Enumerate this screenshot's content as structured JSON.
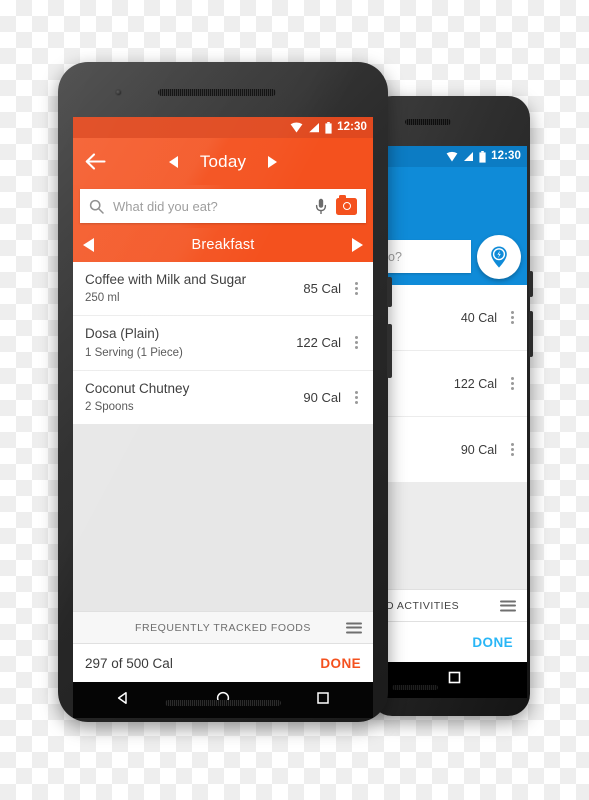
{
  "background": {
    "style": "transparent-checkerboard",
    "light": "#ffffff",
    "dark": "#eeeeee"
  },
  "front_phone": {
    "device": "dark-android-phone",
    "accent_color": "#f4511e",
    "status_bar": {
      "wifi_icon": "wifi-icon",
      "signal_icon": "cellular-signal-icon",
      "battery_icon": "battery-icon",
      "time": "12:30"
    },
    "top_bar": {
      "back_icon": "arrow-left-icon",
      "prev_icon": "triangle-left-icon",
      "title": "Today",
      "next_icon": "triangle-right-icon"
    },
    "search": {
      "search_icon": "search-icon",
      "placeholder": "What did you eat?",
      "value": "",
      "mic_icon": "microphone-icon",
      "camera_icon": "camera-icon"
    },
    "meal_bar": {
      "prev_icon": "triangle-left-icon",
      "title": "Breakfast",
      "next_icon": "triangle-right-icon"
    },
    "food_items": [
      {
        "name": "Coffee with Milk and Sugar",
        "portion": "250 ml",
        "calories": "85 Cal",
        "menu_icon": "kebab-menu-icon"
      },
      {
        "name": "Dosa (Plain)",
        "portion": "1 Serving (1 Piece)",
        "calories": "122 Cal",
        "menu_icon": "kebab-menu-icon"
      },
      {
        "name": "Coconut Chutney",
        "portion": "2 Spoons",
        "calories": "90 Cal",
        "menu_icon": "kebab-menu-icon"
      }
    ],
    "section_strip": {
      "label": "FREQUENTLY TRACKED FOODS",
      "menu_icon": "hamburger-menu-icon"
    },
    "footer": {
      "summary": "297 of 500 Cal",
      "done_label": "DONE",
      "done_color": "#f4511e"
    },
    "system_nav": {
      "back_icon": "android-back-triangle-icon",
      "home_icon": "android-home-circle-icon",
      "recents_icon": "android-recents-square-icon"
    }
  },
  "back_phone": {
    "device": "dark-android-phone",
    "accent_color": "#0f8bd8",
    "status_bar": {
      "wifi_icon": "wifi-icon",
      "signal_icon": "cellular-signal-icon",
      "battery_icon": "battery-icon",
      "time": "12:30"
    },
    "search": {
      "placeholder_visible": "o?",
      "fab_icon": "location-pin-activity-icon"
    },
    "food_items": [
      {
        "calories": "40 Cal",
        "menu_icon": "kebab-menu-icon"
      },
      {
        "calories": "122 Cal",
        "menu_icon": "kebab-menu-icon"
      },
      {
        "calories": "90 Cal",
        "menu_icon": "kebab-menu-icon"
      }
    ],
    "section_strip": {
      "label": "D ACTIVITIES",
      "menu_icon": "hamburger-menu-icon"
    },
    "footer": {
      "done_label": "DONE",
      "done_color": "#29b6f6"
    },
    "system_nav": {
      "recents_icon": "android-recents-square-icon"
    }
  }
}
